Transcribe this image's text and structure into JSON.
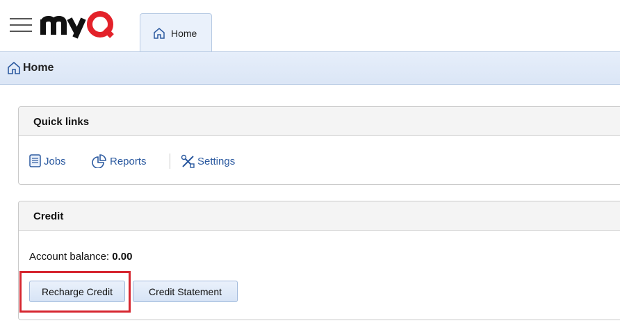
{
  "header": {
    "logo_text": "myQ",
    "tab_label": "Home"
  },
  "breadcrumb": {
    "label": "Home"
  },
  "quick_links": {
    "title": "Quick links",
    "links": [
      {
        "label": "Jobs",
        "icon": "jobs-icon"
      },
      {
        "label": "Reports",
        "icon": "reports-icon"
      },
      {
        "label": "Settings",
        "icon": "settings-icon"
      }
    ]
  },
  "credit": {
    "title": "Credit",
    "balance_label": "Account balance:",
    "balance_value": "0.00",
    "recharge_label": "Recharge Credit",
    "statement_label": "Credit Statement"
  },
  "colors": {
    "brand_red": "#e3222a",
    "link_blue": "#2c5aa0",
    "highlight_red": "#d6262f"
  }
}
